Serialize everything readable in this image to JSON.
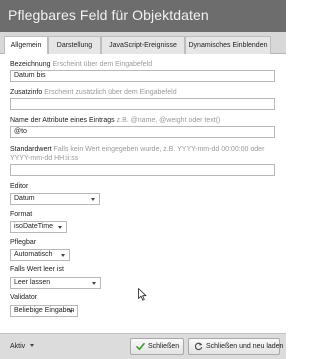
{
  "window": {
    "title": "Pflegbares Feld für Objektdaten"
  },
  "tabs": [
    {
      "label": "Allgemein",
      "active": true
    },
    {
      "label": "Darstellung",
      "active": false
    },
    {
      "label": "JavaScript-Ereignisse",
      "active": false
    },
    {
      "label": "Dynamisches Einblenden",
      "active": false
    }
  ],
  "form": {
    "bezeichnung": {
      "label": "Bezeichnung",
      "hint": "Erscheint über dem Eingabefeld",
      "value": "Datum bis"
    },
    "zusatzinfo": {
      "label": "Zusatzinfo",
      "hint": "Erscheint zusätzlich über dem Eingabefeld",
      "value": ""
    },
    "attribute": {
      "label": "Name der Attribute eines Eintrags",
      "hint": "z.B. @name, @weight oder text()",
      "value": "@to"
    },
    "standardwert": {
      "label": "Standardwert",
      "hint": "Falls kein Wert eingegeben wurde, z.B. YYYY-mm-dd 00:00:00 oder YYYY-mm-dd HH:ii:ss",
      "value": ""
    },
    "editor": {
      "label": "Editor",
      "value": "Datum"
    },
    "format": {
      "label": "Format",
      "value": "isoDateTime"
    },
    "pflegbar": {
      "label": "Pflegbar",
      "value": "Automatisch"
    },
    "falls_leer": {
      "label": "Falls Wert leer ist",
      "value": "Leer lassen"
    },
    "validator": {
      "label": "Validator",
      "value": "Beliebige Eingaben"
    }
  },
  "footer": {
    "status": "Aktiv",
    "close_label": "Schließen",
    "reload_label": "Schließen und neu laden"
  },
  "colors": {
    "titlebar": "#6d6d6d",
    "close_check": "#3a9a2a",
    "footer": "#dcdcdc"
  }
}
